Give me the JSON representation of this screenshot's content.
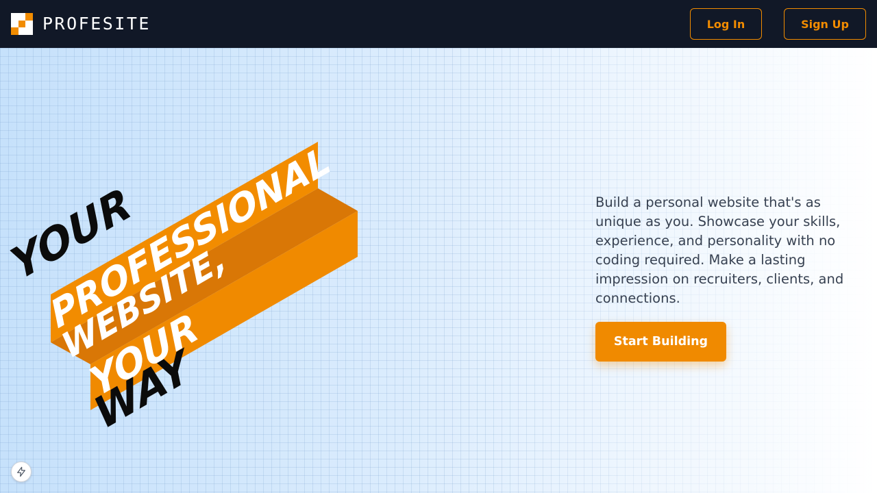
{
  "header": {
    "brand": "PROFESITE",
    "login_label": "Log In",
    "signup_label": "Sign Up"
  },
  "hero": {
    "art_lines": [
      "YOUR",
      "PROFESSIONAL",
      "WEBSITE,",
      "YOUR",
      "WAY"
    ],
    "description": "Build a personal website that's as unique as you. Showcase your skills, experience, and personality with no coding required. Make a lasting impression on recruiters, clients, and connections.",
    "cta_label": "Start Building"
  },
  "icons": {
    "logo": "pixel-checker-logo-icon",
    "floating": "lightning-bolt-icon"
  },
  "colors": {
    "header_bg": "#111827",
    "accent": "#f08a00",
    "accent_dark": "#d97706",
    "text": "#374151"
  }
}
